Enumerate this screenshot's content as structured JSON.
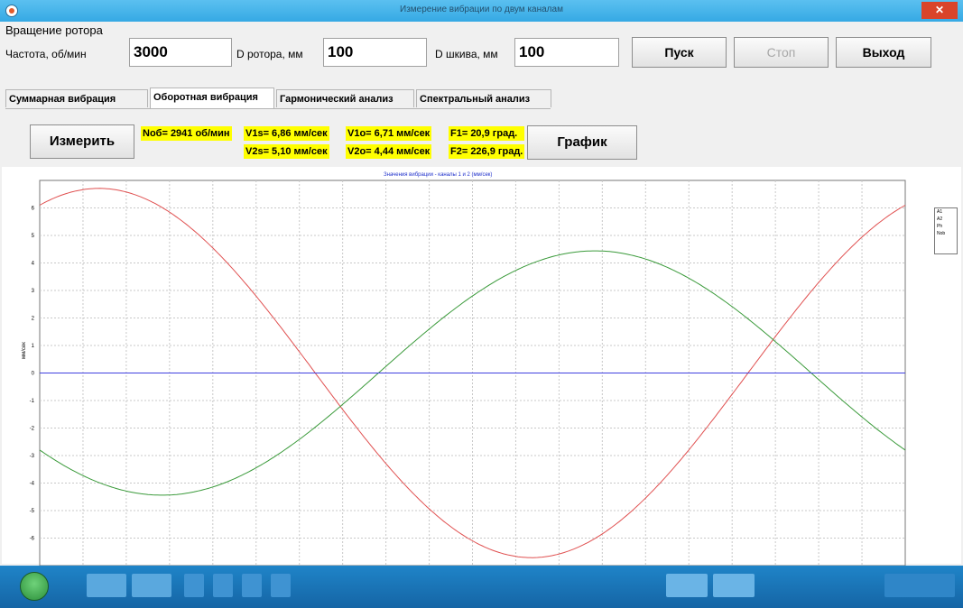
{
  "window": {
    "title": "Измерение вибрации по двум каналам",
    "close_label": "✕"
  },
  "rotor": {
    "section_label": "Вращение ротора",
    "freq_label": "Частота, об/мин",
    "freq_value": "3000",
    "rotor_d_label": "D ротора, мм",
    "rotor_d_value": "100",
    "pulley_d_label": "D шкива, мм",
    "pulley_d_value": "100"
  },
  "buttons": {
    "start": "Пуск",
    "stop": "Стоп",
    "exit": "Выход",
    "measure": "Измерить",
    "chart": "График"
  },
  "tabs": [
    "Суммарная вибрация",
    "Оборотная вибрация",
    "Гармонический анализ",
    "Спектральный анализ"
  ],
  "active_tab": "Оборотная вибрация",
  "readings": {
    "nob": "Nоб= 2941 об/мин",
    "v1s": "V1s= 6,86 мм/сек",
    "v1o": "V1о= 6,71 мм/сек",
    "f1": "F1= 20,9 град.",
    "v2s": "V2s= 5,10 мм/сек",
    "v2o": "V2о= 4,44 мм/сек",
    "f2": "F2= 226,9 град."
  },
  "chart_data": {
    "type": "line",
    "title": "Значения вибрации - каналы 1 и 2 (мм/сек)",
    "ylabel": "мм/сек",
    "ylim": [
      -7,
      7
    ],
    "yticks": [
      6,
      5,
      4,
      3,
      2,
      1,
      0,
      -1,
      -2,
      -3,
      -4,
      -5,
      -6
    ],
    "xlim": [
      0,
      360
    ],
    "grid": true,
    "legend_position": "right",
    "legend": [
      "A1",
      "A2",
      "Ph",
      "Nob"
    ],
    "series": [
      {
        "name": "A1",
        "color": "#e05050",
        "amplitude": 6.71,
        "phase_deg": 20.9,
        "x": [
          0,
          30,
          60,
          90,
          120,
          150,
          180,
          210,
          240,
          270,
          300,
          330,
          360
        ],
        "values": [
          6.1,
          6.6,
          5.3,
          2.9,
          -0.4,
          -3.6,
          -5.9,
          -6.6,
          -5.3,
          -2.6,
          0.8,
          4.0,
          6.1
        ]
      },
      {
        "name": "A2",
        "color": "#3a9a3a",
        "amplitude": 4.44,
        "phase_deg": 226.9,
        "x": [
          0,
          30,
          60,
          90,
          120,
          150,
          180,
          210,
          240,
          270,
          300,
          330,
          360
        ],
        "values": [
          -2.8,
          -4.1,
          -4.3,
          -3.4,
          -1.6,
          0.6,
          2.9,
          4.2,
          4.4,
          3.4,
          1.2,
          -1.0,
          -2.8
        ]
      },
      {
        "name": "Ph",
        "color": "#4040e0",
        "x": [
          0,
          360
        ],
        "values": [
          0,
          0
        ]
      }
    ]
  },
  "colors": {
    "readout_bg": "#ffff00",
    "titlebar": "#3fb0e8",
    "taskbar": "#1a74b8"
  }
}
